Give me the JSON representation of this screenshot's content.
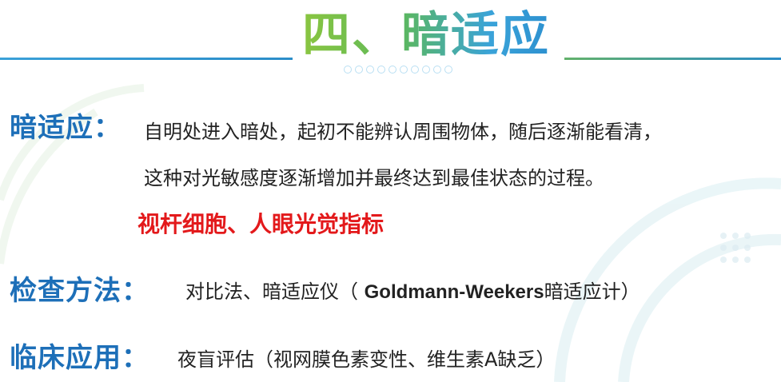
{
  "slide": {
    "title": "四、暗适应",
    "accent_colors": {
      "heading_blue": "#1d6fb8",
      "emphasis_red": "#e3191b",
      "title_green": "#8cc63f",
      "title_blue": "#2c8fcf"
    }
  },
  "sections": {
    "definition": {
      "heading": "暗适应：",
      "line1": "自明处进入暗处，起初不能辨认周围物体，随后逐渐能看清，",
      "line2": "这种对光敏感度逐渐增加并最终达到最佳状态的过程。",
      "highlight": "视杆细胞、人眼光觉指标"
    },
    "method": {
      "heading": "检查方法：",
      "text_part1": "对比法、暗适应仪（ ",
      "device": "Goldmann-Weekers",
      "text_part2": "暗适应计）"
    },
    "clinical": {
      "heading": "临床应用：",
      "text": "夜盲评估（视网膜色素变性、维生素A缺乏）"
    }
  }
}
